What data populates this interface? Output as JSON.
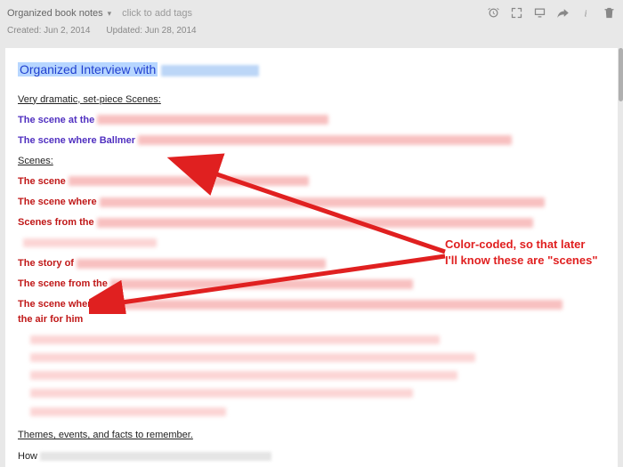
{
  "header": {
    "notebook": "Organized book notes",
    "tag_prompt": "click to add tags",
    "created_label": "Created:",
    "created_value": "Jun 2, 2014",
    "updated_label": "Updated:",
    "updated_value": "Jun 28, 2014"
  },
  "note": {
    "title_prefix": "Organized Interview with",
    "section_dramatic": "Very dramatic, set-piece Scenes:",
    "scene_at_the": "The scene at the",
    "scene_ballmer": "The scene where Ballmer",
    "section_scenes": "Scenes:",
    "scene_generic": "The scene",
    "scene_where": "The scene where",
    "scenes_from_the": "Scenes from the",
    "story_of": "The story of",
    "scene_from_1": "The scene from the",
    "scene_where_2": "The scene where",
    "air_line2": "the air for him",
    "section_themes": "Themes, events, and facts to remember.",
    "how_line": "How"
  },
  "annotation": {
    "line1": "Color-coded, so that later",
    "line2": "I'll know these are \"scenes\""
  }
}
